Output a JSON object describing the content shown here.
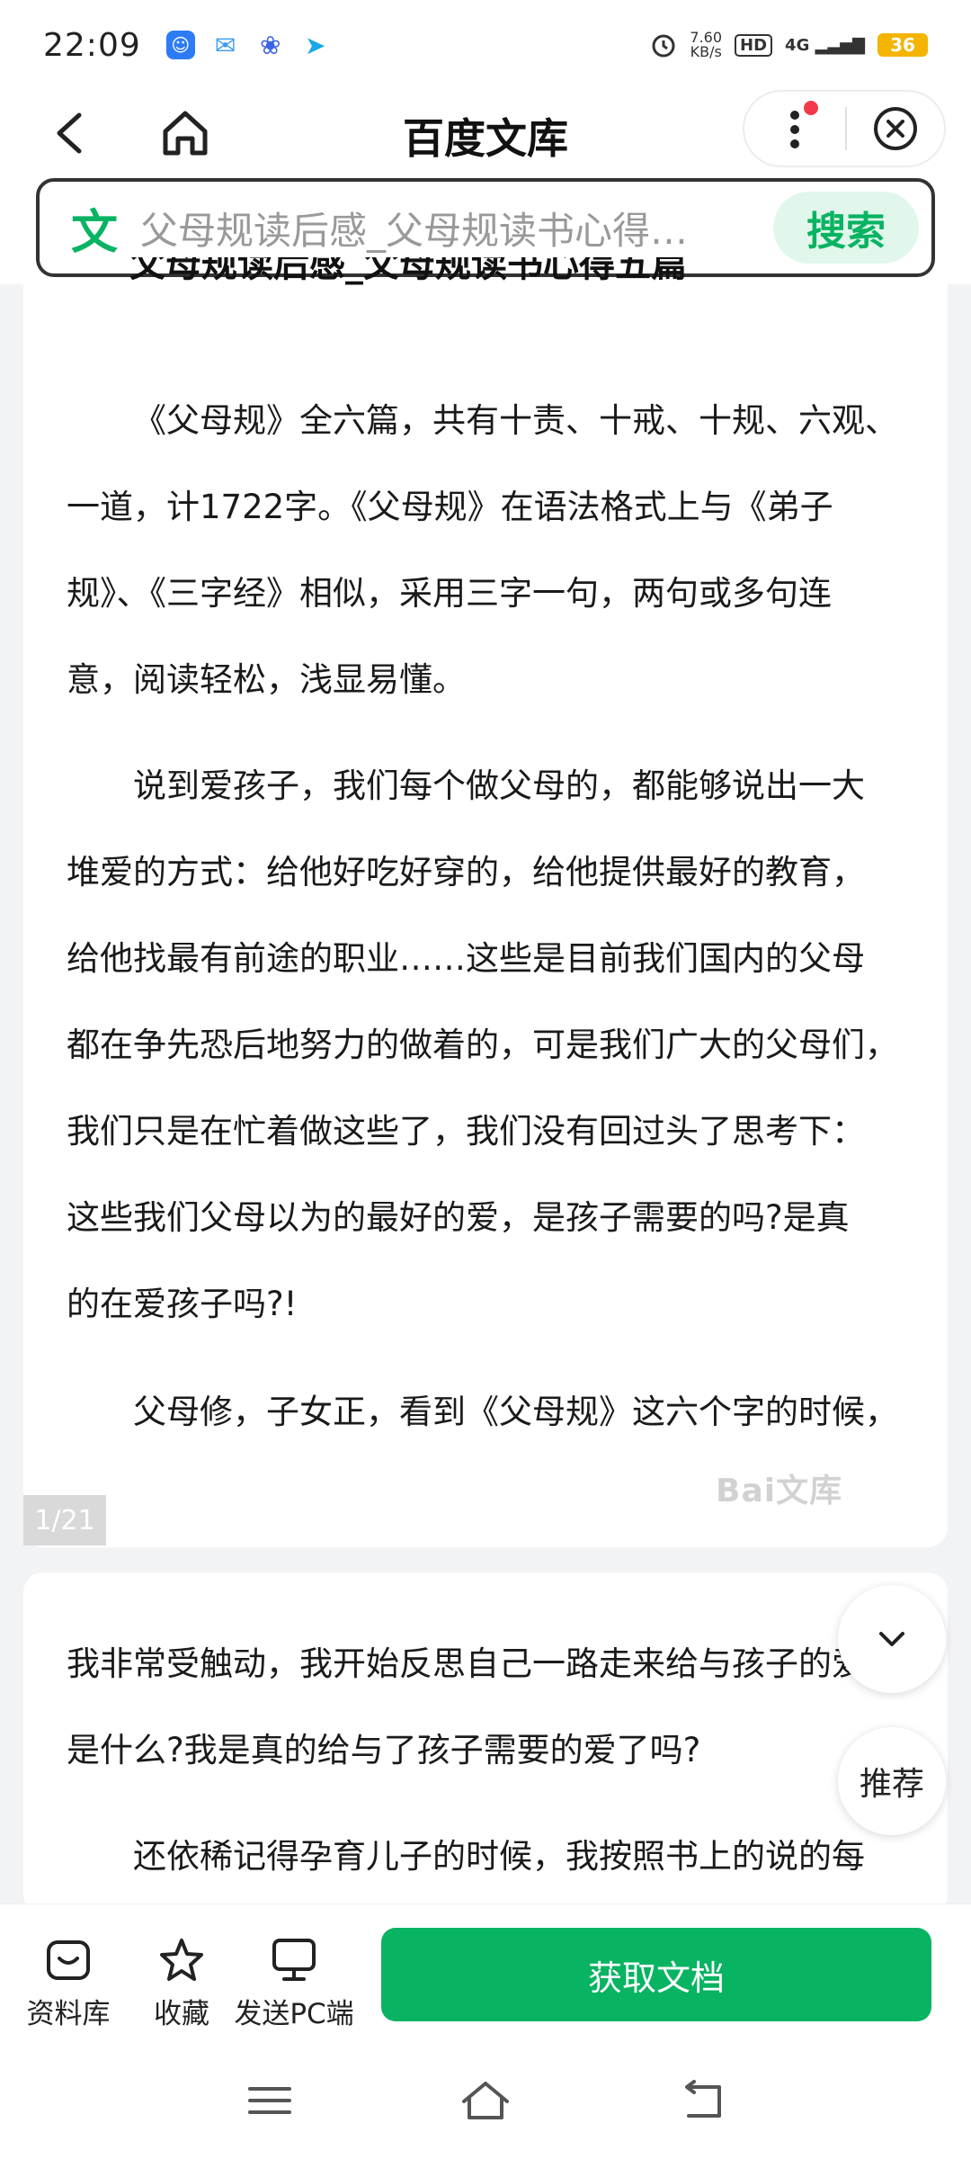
{
  "status_bar": {
    "time": "22:09",
    "net_speed_value": "7.60",
    "net_speed_unit": "KB/s",
    "hd": "HD",
    "signal": "4G",
    "battery": "36"
  },
  "nav": {
    "title": "百度文库"
  },
  "search": {
    "logo": "文",
    "text": "父母规读后感_父母规读书心得…",
    "button": "搜索"
  },
  "document": {
    "title": "父母规读后感_父母规读书心得五篇",
    "page1_lines": [
      "《父母规》全六篇，共有十责、十戒、十规、六观、",
      "一道，计1722字。《父母规》在语法格式上与《弟子",
      "规》、《三字经》相似，采用三字一句，两句或多句连",
      "意，阅读轻松，浅显易懂。",
      "说到爱孩子，我们每个做父母的，都能够说出一大",
      "堆爱的方式：给他好吃好穿的，给他提供最好的教育，",
      "给他找最有前途的职业……这些是目前我们国内的父母",
      "都在争先恐后地努力的做着的，可是我们广大的父母们，",
      "我们只是在忙着做这些了，我们没有回过头了思考下：",
      "这些我们父母以为的最好的爱，是孩子需要的吗?是真",
      "的在爱孩子吗?!",
      "父母修，子女正，看到《父母规》这六个字的时候，"
    ],
    "page_indicator": "1/21",
    "watermark": "Bai文库",
    "page2_lines": [
      "我非常受触动，我开始反思自己一路走来给与孩子的爱",
      "是什么?我是真的给与了孩子需要的爱了吗?",
      "还依稀记得孕育儿子的时候，我按照书上的说的每"
    ]
  },
  "floating": {
    "recommend": "推荐"
  },
  "toolbar": {
    "library": "资料库",
    "favorite": "收藏",
    "send_pc": "发送PC端",
    "get_doc": "获取文档"
  }
}
